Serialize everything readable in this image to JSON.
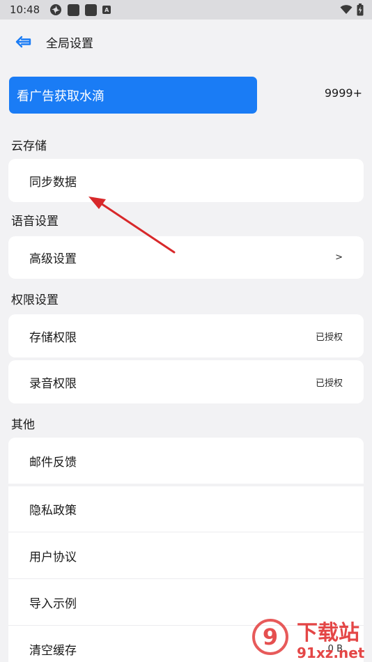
{
  "status_bar": {
    "time": "10:48",
    "notification_badge": "A"
  },
  "header": {
    "title": "全局设置"
  },
  "ad": {
    "label": "看广告获取水滴",
    "count": "9999+"
  },
  "sections": {
    "cloud": {
      "title": "云存储",
      "sync_label": "同步数据"
    },
    "voice": {
      "title": "语音设置",
      "advanced_label": "高级设置",
      "advanced_value": ">"
    },
    "permissions": {
      "title": "权限设置",
      "storage_label": "存储权限",
      "storage_value": "已授权",
      "record_label": "录音权限",
      "record_value": "已授权"
    },
    "other": {
      "title": "其他",
      "items": [
        {
          "label": "邮件反馈"
        },
        {
          "label": "隐私政策"
        },
        {
          "label": "用户协议"
        },
        {
          "label": "导入示例"
        },
        {
          "label": "清空缓存",
          "value": "0 B"
        }
      ]
    }
  },
  "watermark": {
    "brand": "下载站",
    "domain": "91xz.net",
    "logo_mark": "9"
  },
  "colors": {
    "accent": "#1a7cf5",
    "background": "#f2f2f4",
    "annotation_arrow": "#d8282a"
  }
}
